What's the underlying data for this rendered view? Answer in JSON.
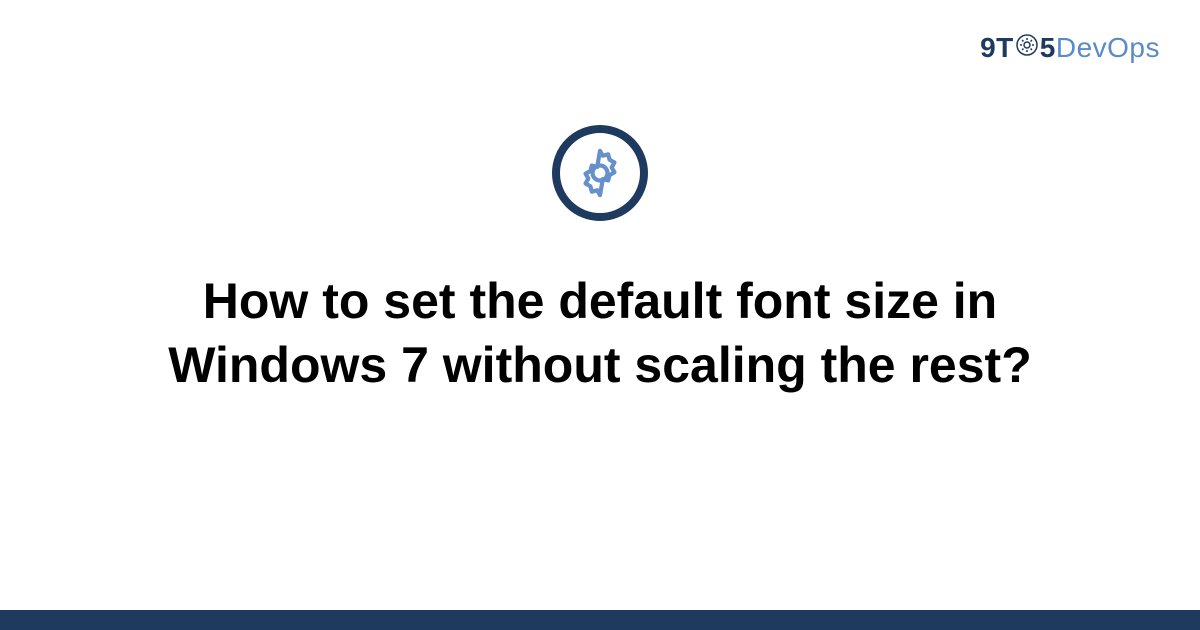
{
  "logo": {
    "part1": "9T",
    "part2": "5",
    "part3": "DevOps"
  },
  "title": "How to set the default font size in Windows 7 without scaling the rest?",
  "colors": {
    "dark_blue": "#1e3a5f",
    "light_blue": "#5a8bc9",
    "icon_blue": "#6690cc"
  }
}
